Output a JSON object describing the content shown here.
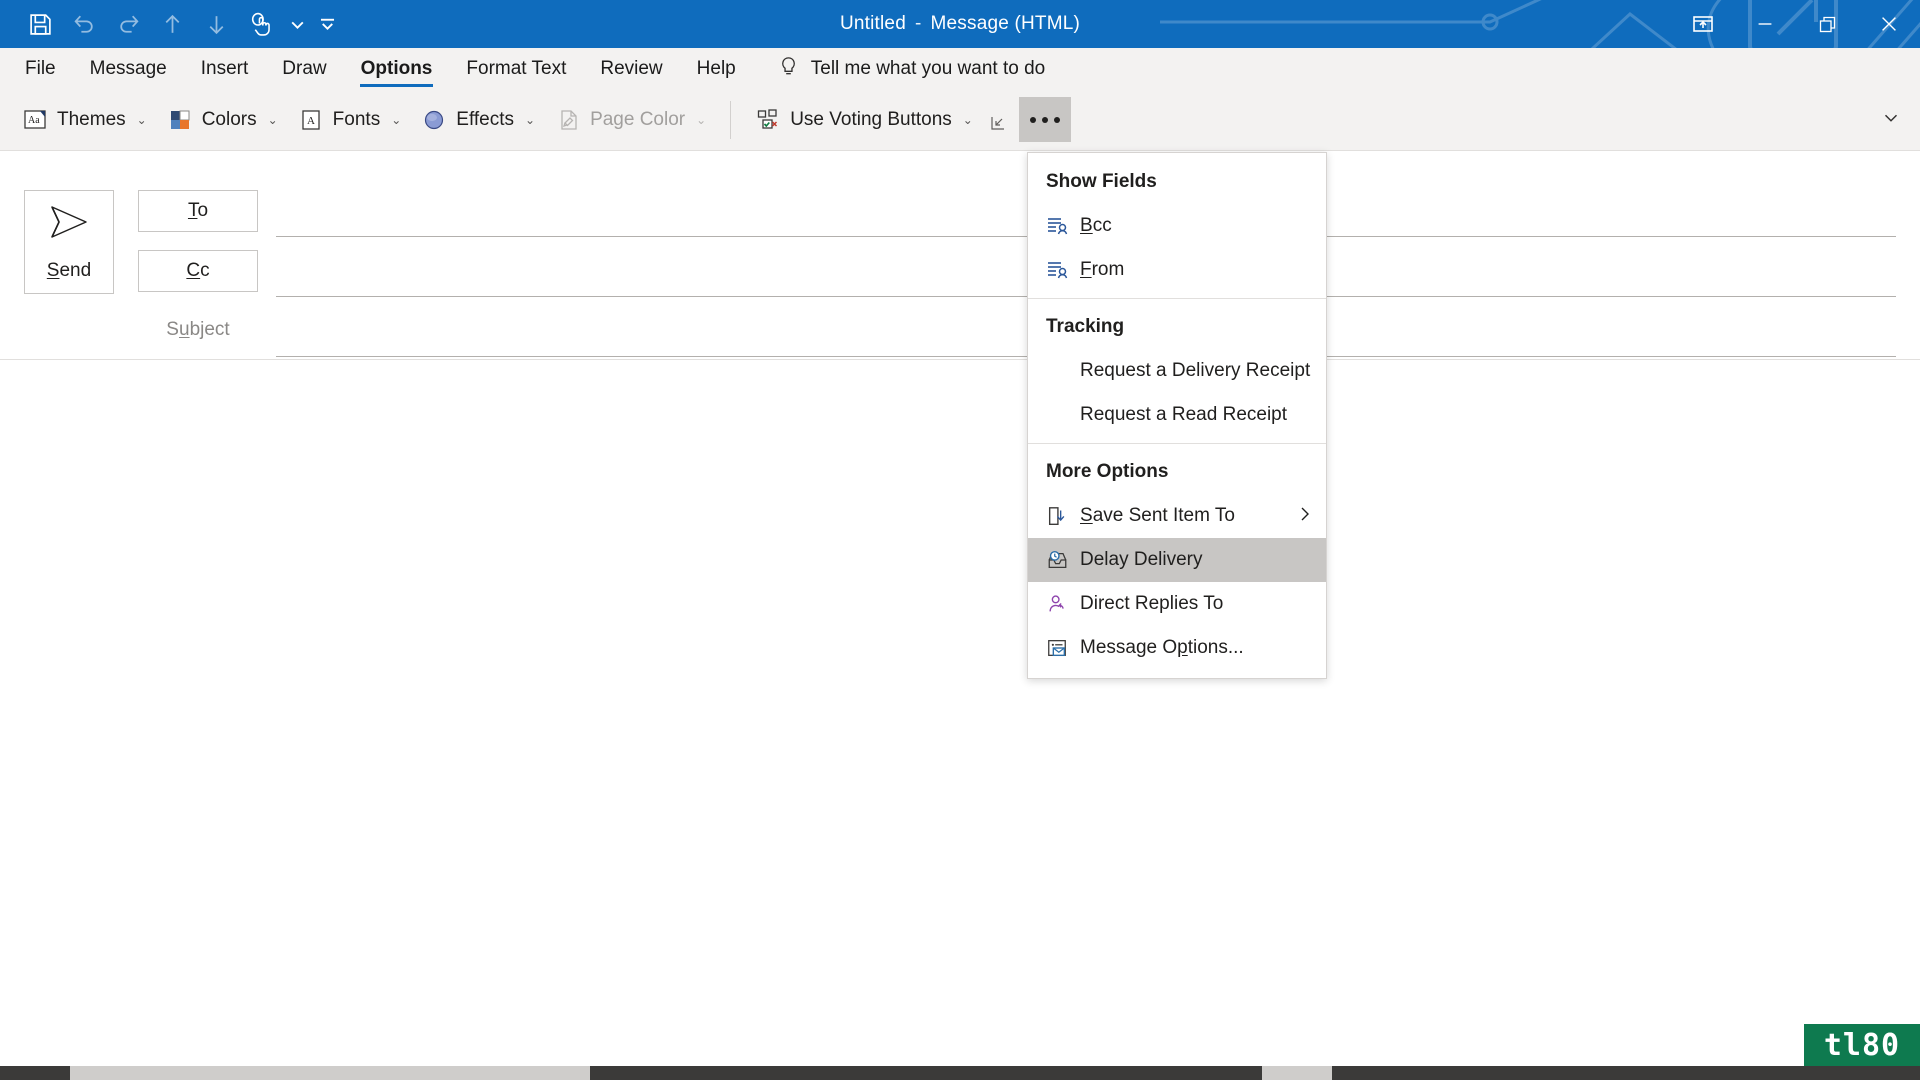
{
  "window": {
    "title_main": "Untitled",
    "title_sep": "-",
    "title_doc": "Message (HTML)",
    "accent_color": "#0f6cbd",
    "controls": [
      {
        "name": "ribbon-display-options",
        "label": "Ribbon Display Options"
      },
      {
        "name": "minimize",
        "label": "Minimize"
      },
      {
        "name": "restore",
        "label": "Restore Down"
      },
      {
        "name": "close",
        "label": "Close"
      }
    ]
  },
  "quick_access_toolbar": {
    "items": [
      {
        "name": "save-icon",
        "label": "Save",
        "enabled": true
      },
      {
        "name": "undo-icon",
        "label": "Undo",
        "enabled": false
      },
      {
        "name": "redo-icon",
        "label": "Redo",
        "enabled": false
      },
      {
        "name": "previous-item-icon",
        "label": "Previous Item",
        "enabled": false
      },
      {
        "name": "next-item-icon",
        "label": "Next Item",
        "enabled": false
      },
      {
        "name": "touch-mouse-mode-icon",
        "label": "Touch/Mouse Mode",
        "enabled": true
      },
      {
        "name": "touch-mode-dropdown-icon",
        "label": "Touch Mode Options",
        "enabled": true
      },
      {
        "name": "customize-qat-icon",
        "label": "Customize Quick Access Toolbar",
        "enabled": true
      }
    ]
  },
  "tabs": [
    {
      "label": "File",
      "active": false
    },
    {
      "label": "Message",
      "active": false
    },
    {
      "label": "Insert",
      "active": false
    },
    {
      "label": "Draw",
      "active": false
    },
    {
      "label": "Options",
      "active": true
    },
    {
      "label": "Format Text",
      "active": false
    },
    {
      "label": "Review",
      "active": false
    },
    {
      "label": "Help",
      "active": false
    }
  ],
  "tell_me": {
    "placeholder": "Tell me what you want to do",
    "icon": "lightbulb-icon"
  },
  "ribbon": {
    "buttons": [
      {
        "label": "Themes",
        "icon": "themes-icon",
        "dropdown": true,
        "disabled": false
      },
      {
        "label": "Colors",
        "icon": "colors-icon",
        "dropdown": true,
        "disabled": false
      },
      {
        "label": "Fonts",
        "icon": "fonts-icon",
        "dropdown": true,
        "disabled": false
      },
      {
        "label": "Effects",
        "icon": "effects-icon",
        "dropdown": true,
        "disabled": false
      },
      {
        "label": "Page Color",
        "icon": "page-color-icon",
        "dropdown": true,
        "disabled": true
      }
    ],
    "voting": {
      "label": "Use Voting Buttons",
      "icon": "voting-buttons-icon",
      "dropdown": true
    },
    "dialog_launcher": "dialog-box-launcher-icon",
    "more_commands": "...",
    "collapse": "collapse-ribbon-icon",
    "chevron": "⌄"
  },
  "compose": {
    "send_label": "Send",
    "send_accel": "S",
    "to_label": "To",
    "to_accel": "T",
    "cc_label": "Cc",
    "cc_accel": "C",
    "subject_label": "Subject",
    "subject_value": "",
    "to_value": "",
    "cc_value": ""
  },
  "menu": {
    "sections": [
      {
        "header": "Show Fields",
        "items": [
          {
            "label": "Bcc",
            "accel": "B",
            "icon": "show-bcc-field-icon",
            "highlighted": false,
            "submenu": false
          },
          {
            "label": "From",
            "accel": "F",
            "icon": "show-from-field-icon",
            "highlighted": false,
            "submenu": false
          }
        ]
      },
      {
        "header": "Tracking",
        "items": [
          {
            "label": "Request a Delivery Receipt",
            "accel": "",
            "icon": "",
            "highlighted": false,
            "submenu": false
          },
          {
            "label": "Request a Read Receipt",
            "accel": "",
            "icon": "",
            "highlighted": false,
            "submenu": false
          }
        ]
      },
      {
        "header": "More Options",
        "items": [
          {
            "label": "Save Sent Item To",
            "accel": "S",
            "icon": "save-sent-item-icon",
            "highlighted": false,
            "submenu": true
          },
          {
            "label": "Delay Delivery",
            "accel": "",
            "icon": "delay-delivery-icon",
            "highlighted": true,
            "submenu": false
          },
          {
            "label": "Direct Replies To",
            "accel": "",
            "icon": "direct-replies-icon",
            "highlighted": false,
            "submenu": false
          },
          {
            "label": "Message Options...",
            "accel": "p",
            "icon": "message-options-icon",
            "highlighted": false,
            "submenu": false
          }
        ]
      }
    ],
    "submenu_chevron": "›"
  },
  "watermark": {
    "text": "tl80",
    "color": "#0e7a4f"
  }
}
